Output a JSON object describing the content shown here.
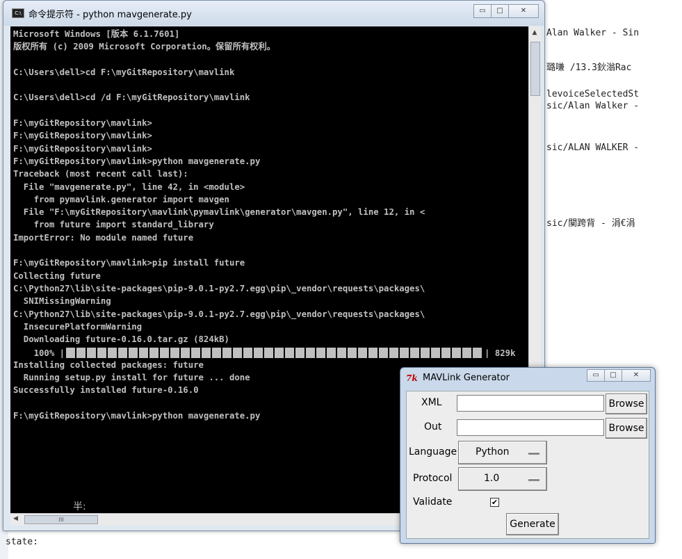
{
  "background": {
    "right_lines": [
      "Alan Walker - Sin",
      "璐嗛 /13.3鈥滃Rac",
      "levoiceSelectedSt",
      "sic/Alan Walker -",
      "sic/ALAN WALKER -",
      "sic/闃跨背 - 涓€涓"
    ],
    "bottom_lines": [
      "state:"
    ]
  },
  "cmd_window": {
    "title": "命令提示符 - python  mavgenerate.py",
    "icon": "cmd-icon",
    "buttons": {
      "minimize": "▭",
      "maximize": "□",
      "close": "✕"
    },
    "console_text": "Microsoft Windows [版本 6.1.7601]\n版权所有 (c) 2009 Microsoft Corporation。保留所有权利。\n\nC:\\Users\\dell>cd F:\\myGitRepository\\mavlink\n\nC:\\Users\\dell>cd /d F:\\myGitRepository\\mavlink\n\nF:\\myGitRepository\\mavlink>\nF:\\myGitRepository\\mavlink>\nF:\\myGitRepository\\mavlink>\nF:\\myGitRepository\\mavlink>python mavgenerate.py\nTraceback (most recent call last):\n  File \"mavgenerate.py\", line 42, in <module>\n    from pymavlink.generator import mavgen\n  File \"F:\\myGitRepository\\mavlink\\pymavlink\\generator\\mavgen.py\", line 12, in <\n    from future import standard_library\nImportError: No module named future\n\nF:\\myGitRepository\\mavlink>pip install future\nCollecting future\nC:\\Python27\\lib\\site-packages\\pip-9.0.1-py2.7.egg\\pip\\_vendor\\requests\\packages\\\n  SNIMissingWarning\nC:\\Python27\\lib\\site-packages\\pip-9.0.1-py2.7.egg\\pip\\_vendor\\requests\\packages\\\n  InsecurePlatformWarning\n  Downloading future-0.16.0.tar.gz (824kB)\n\nInstalling collected packages: future\n  Running setup.py install for future ... done\nSuccessfully installed future-0.16.0\n\nF:\\myGitRepository\\mavlink>python mavgenerate.py",
    "progress": {
      "label": "    100% |",
      "end": "| 829k",
      "percent": 100
    },
    "ime_text": "半:",
    "hscroll_thumb": "III"
  },
  "mav_window": {
    "title": "MAVLink Generator",
    "logo": "7k",
    "buttons": {
      "minimize": "▭",
      "maximize": "□",
      "close": "✕"
    },
    "xml_label": "XML",
    "xml_value": "",
    "out_label": "Out",
    "out_value": "",
    "browse_label": "Browse",
    "language_label": "Language",
    "language_value": "Python",
    "protocol_label": "Protocol",
    "protocol_value": "1.0",
    "validate_label": "Validate",
    "validate_checked": true,
    "validate_mark": "✔",
    "generate_label": "Generate"
  }
}
